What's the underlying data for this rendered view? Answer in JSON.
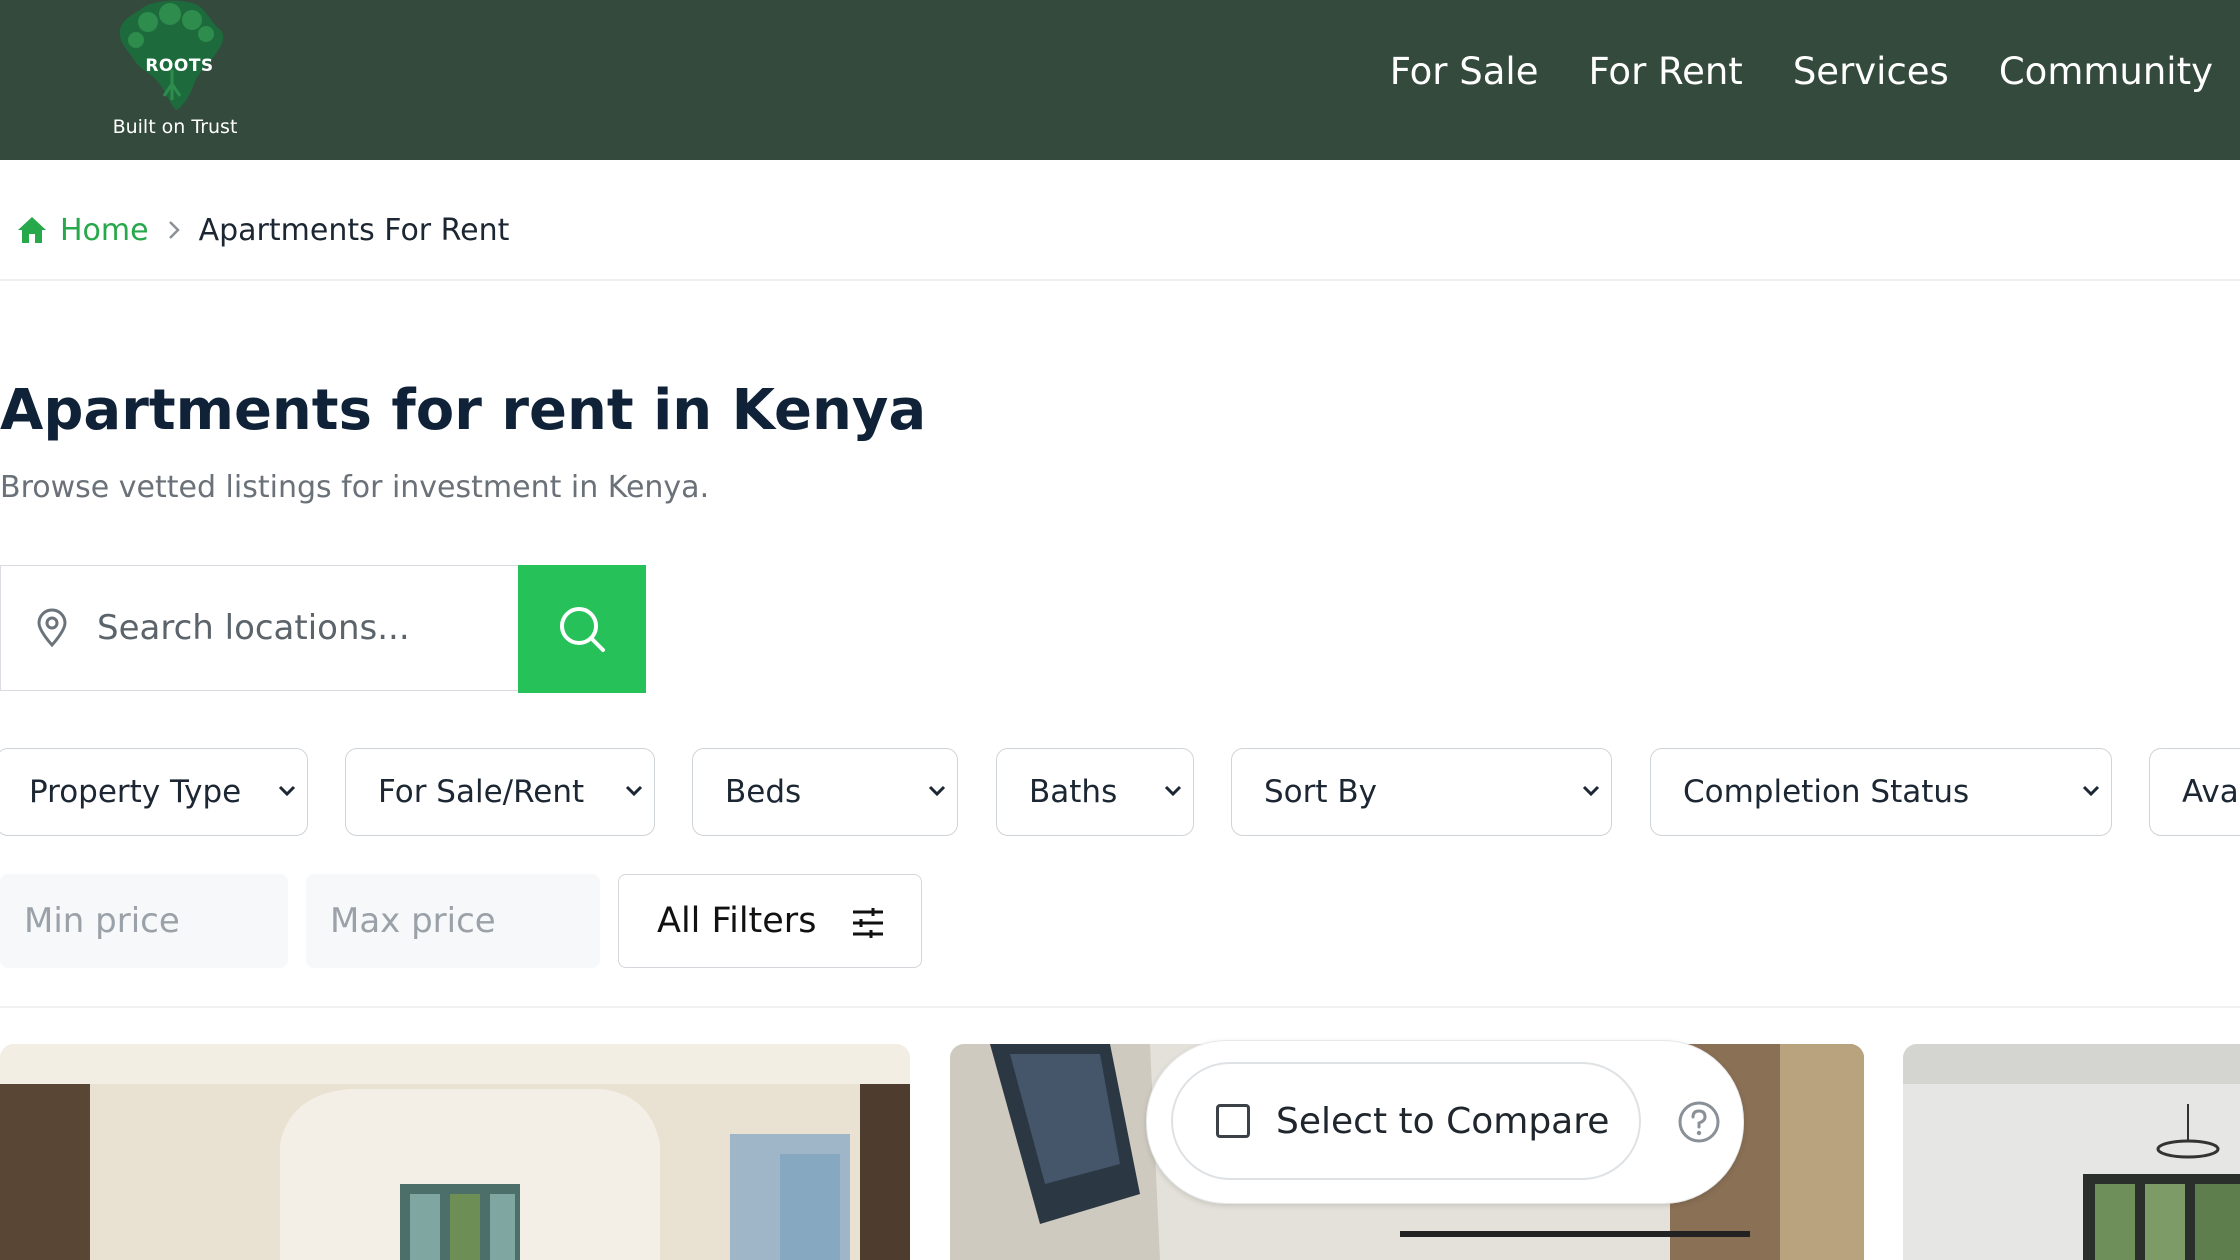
{
  "header": {
    "logo_word": "ROOTS",
    "logo_tagline": "Built on Trust",
    "nav": [
      "For Sale",
      "For Rent",
      "Services",
      "Community"
    ]
  },
  "breadcrumb": {
    "home": "Home",
    "current": "Apartments For Rent"
  },
  "page": {
    "title": "Apartments for rent in Kenya",
    "subtitle": "Browse vetted listings for investment in Kenya."
  },
  "search": {
    "placeholder": "Search locations..."
  },
  "filters": {
    "dropdowns": [
      "Property Type",
      "For Sale/Rent",
      "Beds",
      "Baths",
      "Sort By",
      "Completion Status",
      "Ava"
    ],
    "min_price_placeholder": "Min price ...",
    "max_price_placeholder": "Max price ...",
    "all_filters": "All Filters"
  },
  "compare": {
    "label": "Select to Compare"
  },
  "colors": {
    "header_bg": "#334a3c",
    "accent_green": "#27c15a",
    "link_green": "#27a84a",
    "title_navy": "#0f2238"
  }
}
